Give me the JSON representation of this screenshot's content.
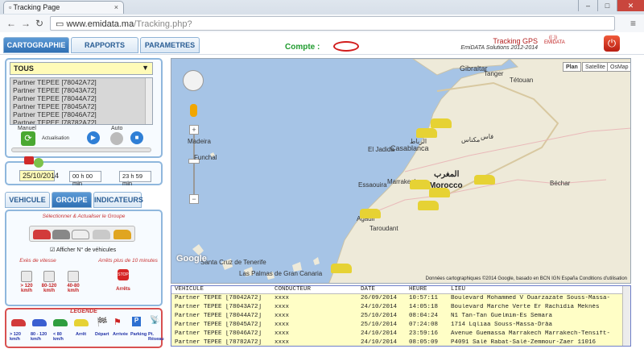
{
  "browser": {
    "tab_title": "Tracking Page",
    "url_host": "www.emidata.ma",
    "url_path": "/Tracking.php?"
  },
  "header": {
    "tabs": [
      {
        "label": "CARTOGRAPHIE",
        "active": true
      },
      {
        "label": "RAPPORTS",
        "active": false
      },
      {
        "label": "PARAMETRES",
        "active": false
      }
    ],
    "compte_label": "Compte :",
    "brand_line1": "Tracking GPS",
    "brand_line2": "EmiDATA Solutions 2012-2014",
    "logo_text": "EMIDATA"
  },
  "vehicle_panel": {
    "select_value": "TOUS",
    "vehicles": [
      "Partner TEPEE [78042A72]",
      "Partner TEPEE [78043A72]",
      "Partner TEPEE [78044A72]",
      "Partner TEPEE [78045A72]",
      "Partner TEPEE [78046A72]",
      "Partner TEPEE [78782A72]"
    ],
    "manuel_label": "Manuel",
    "auto_label": "Auto",
    "actualisation_label": "Actualisation"
  },
  "date_panel": {
    "date": "25/10/2014",
    "start_time": "00 h 00 min",
    "end_time": "23 h 59 min"
  },
  "sub_tabs": [
    {
      "label": "VEHICULE",
      "active": false
    },
    {
      "label": "GROUPE",
      "active": true
    },
    {
      "label": "INDICATEURS",
      "active": false
    }
  ],
  "group_panel": {
    "title": "Sélectionner & Actualiser le Groupe",
    "checkbox_label": "Afficher N° de véhicules",
    "speed_title": "Exès de vitesse",
    "stop_title": "Arrêts plus de 10 minutes",
    "speed_labels": [
      "> 120 km/h",
      "80-120 km/h",
      "40-80 km/h"
    ],
    "stop_label": "Arrêts"
  },
  "legend": {
    "title": "LEGENDE",
    "items": [
      {
        "label": "> 120 km/h"
      },
      {
        "label": "80 - 120 km/h"
      },
      {
        "label": "< 80 km/h"
      },
      {
        "label": "Arrêt"
      },
      {
        "label": "Départ"
      },
      {
        "label": "Arrivée"
      },
      {
        "label": "Parking"
      },
      {
        "label": "Pt. Réseau"
      }
    ]
  },
  "map": {
    "types": [
      "Plan",
      "Satellite",
      "OsMap"
    ],
    "active_type": "Plan",
    "cities": {
      "gibraltar": "Gibraltar",
      "tangier": "Tanger",
      "tetouan": "Tétouan",
      "madeira": "Madeira",
      "funchal": "Funchal",
      "rabat": "الرباط",
      "casablanca": "Casablanca",
      "fes": "فاس",
      "meknes": "مكناس",
      "eljadida": "El Jadida",
      "marrakech": "Marrakech",
      "essaouira": "Essaouira",
      "morocco_ar": "المغرب",
      "morocco": "Morocco",
      "agadir": "Agadir",
      "taroudant": "Taroudant",
      "bechar": "Béchar",
      "santacruz": "Santa Cruz de Tenerife",
      "laspalmas": "Las Palmas de Gran Canaria"
    },
    "google_label": "Google",
    "attribution": "Données cartographiques ©2014 Google, basado en BCN IGN España   Conditions d'utilisation"
  },
  "history_table": {
    "columns": [
      "VEHICULE",
      "CONDUCTEUR",
      "DATE",
      "HEURE",
      "LIEU"
    ],
    "rows": [
      [
        "Partner TEPEE [78042A72]",
        "xxxx",
        "26/09/2014",
        "10:57:11",
        "Boulevard Mohammed V Ouarzazate Souss-Massa-"
      ],
      [
        "Partner TEPEE [78043A72]",
        "xxxx",
        "24/10/2014",
        "14:05:18",
        "Boulevard Marche Verte Er Rachidia Meknès"
      ],
      [
        "Partner TEPEE [78044A72]",
        "xxxx",
        "25/10/2014",
        "08:04:24",
        "N1 Tan-Tan Guelmim-Es Semara"
      ],
      [
        "Partner TEPEE [78045A72]",
        "xxxx",
        "25/10/2014",
        "07:24:08",
        "1714 Lqliaa Souss-Massa-Drâa"
      ],
      [
        "Partner TEPEE [78046A72]",
        "xxxx",
        "24/10/2014",
        "23:59:16",
        "Avenue Guemassa Marrakech Marrakech-Tensift-"
      ],
      [
        "Partner TEPEE [78782A72]",
        "xxxx",
        "24/10/2014",
        "08:05:09",
        "P4091 Salé Rabat-Salé-Zemmour-Zaer 11016"
      ]
    ]
  }
}
